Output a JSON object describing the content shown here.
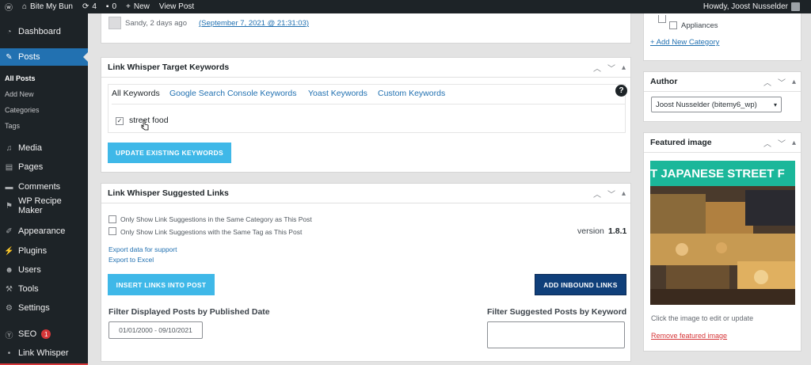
{
  "admin_bar": {
    "site_name": "Bite My Bun",
    "updates_count": "4",
    "comments_count": "0",
    "new_label": "New",
    "view_post_label": "View Post",
    "howdy": "Howdy, Joost Nusselder"
  },
  "sidebar": {
    "dashboard": "Dashboard",
    "posts": "Posts",
    "posts_sub": [
      "All Posts",
      "Add New",
      "Categories",
      "Tags"
    ],
    "media": "Media",
    "pages": "Pages",
    "comments": "Comments",
    "recipe": "WP Recipe Maker",
    "appearance": "Appearance",
    "plugins": "Plugins",
    "users": "Users",
    "tools": "Tools",
    "settings": "Settings",
    "seo": "SEO",
    "seo_badge": "1",
    "link_whisper": "Link Whisper"
  },
  "comment": {
    "author_line": "Sandy, 2 days ago",
    "date_link": "(September 7, 2021 @ 21:31:03)"
  },
  "target_keywords": {
    "title": "Link Whisper Target Keywords",
    "tabs": [
      "All Keywords",
      "Google Search Console Keywords",
      "Yoast Keywords",
      "Custom Keywords"
    ],
    "help": "?",
    "keyword": "street food",
    "update_button": "UPDATE EXISTING KEYWORDS"
  },
  "suggested_links": {
    "title": "Link Whisper Suggested Links",
    "option1": "Only Show Link Suggestions in the Same Category as This Post",
    "option2": "Only Show Link Suggestions with the Same Tag as This Post",
    "version_label": "version",
    "version_number": "1.8.1",
    "export_support": "Export data for support",
    "export_excel": "Export to Excel",
    "insert_button": "INSERT LINKS INTO POST",
    "inbound_button": "ADD INBOUND LINKS",
    "filter_date_label": "Filter Displayed Posts by Published Date",
    "date_range": "01/01/2000 - 09/10/2021",
    "filter_keyword_label": "Filter Suggested Posts by Keyword"
  },
  "categories": {
    "item": "Appliances",
    "add_new": "+ Add New Category"
  },
  "author": {
    "title": "Author",
    "selected": "Joost Nusselder (bitemy6_wp)"
  },
  "featured_image": {
    "title": "Featured image",
    "banner_text": "T JAPANESE STREET F",
    "hint": "Click the image to edit or update",
    "remove": "Remove featured image"
  },
  "colors": {
    "accent": "#2271b1",
    "button_light": "#3fb8e8",
    "button_dark": "#0f3f7a",
    "banner": "#1bb79a"
  }
}
